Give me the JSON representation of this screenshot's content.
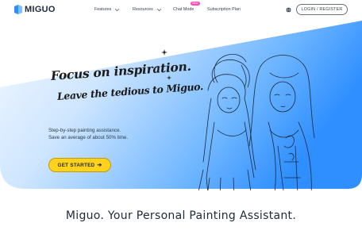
{
  "brand": {
    "name": "MIGUO",
    "logo_icon": "miguo-logo-icon",
    "color": "#2b8ef0"
  },
  "nav": {
    "items": [
      {
        "label": "Features",
        "has_dropdown": true
      },
      {
        "label": "Resources",
        "has_dropdown": true
      },
      {
        "label": "Chat Mode",
        "badge": "New"
      },
      {
        "label": "Subscription Plan"
      }
    ],
    "language_icon": "globe-icon",
    "login_label": "LOGIN / REGISTER"
  },
  "hero": {
    "headline_line1": "Focus on inspiration.",
    "headline_line2": "Leave the tedious to Miguo.",
    "subtext_line1": "Step-by-step painting assistance.",
    "subtext_line2": "Save an average of about 50% time.",
    "cta_label": "GET STARTED",
    "cta_icon": "arrow-right-icon",
    "cta_color": "#ffd31d",
    "gradient_from": "#dbeeff",
    "gradient_to": "#2f8fff"
  },
  "section": {
    "title": "Miguo. Your Personal Painting Assistant."
  }
}
